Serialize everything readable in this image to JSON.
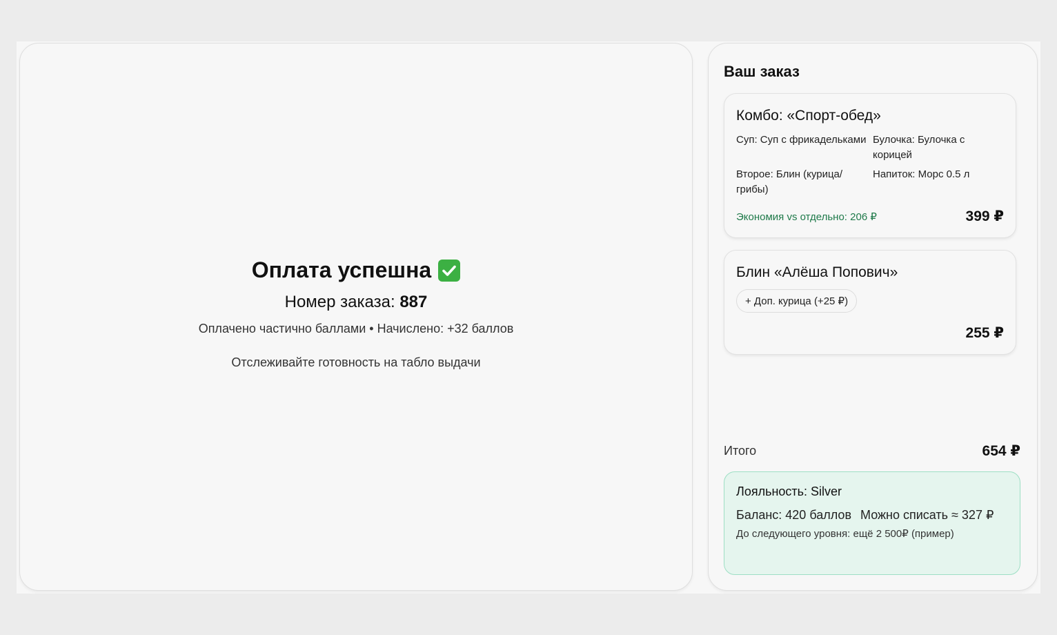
{
  "success": {
    "title": "Оплата успешна",
    "order_label": "Номер заказа:",
    "order_number": "887",
    "paid_info": "Оплачено частично баллами • Начислено: +32 баллов",
    "track_info": "Отслеживайте готовность на табло выдачи"
  },
  "order": {
    "heading": "Ваш заказ",
    "items": [
      {
        "title": "Комбо: «Спорт-обед»",
        "components": [
          "Суп: Суп с фрикадельками",
          "Булочка: Булочка с корицей",
          "Второе: Блин (курица/грибы)",
          "Напиток: Морс 0.5 л"
        ],
        "savings": "Экономия vs отдельно: 206 ₽",
        "price": "399 ₽"
      },
      {
        "title": "Блин «Алёша Попович»",
        "addon": "+ Доп. курица (+25 ₽)",
        "price": "255 ₽"
      }
    ],
    "total_label": "Итого",
    "total_value": "654 ₽"
  },
  "loyalty": {
    "title": "Лояльность: Silver",
    "balance": "Баланс: 420 баллов",
    "can_spend": "Можно списать ≈ 327 ₽",
    "next_level": "До следующего уровня: ещё 2 500₽ (пример)"
  },
  "colors": {
    "savings_green": "#1f7a4a",
    "loyalty_bg": "#e5f5ee",
    "loyalty_border": "#9ddfc4",
    "check_green": "#3cb043"
  }
}
